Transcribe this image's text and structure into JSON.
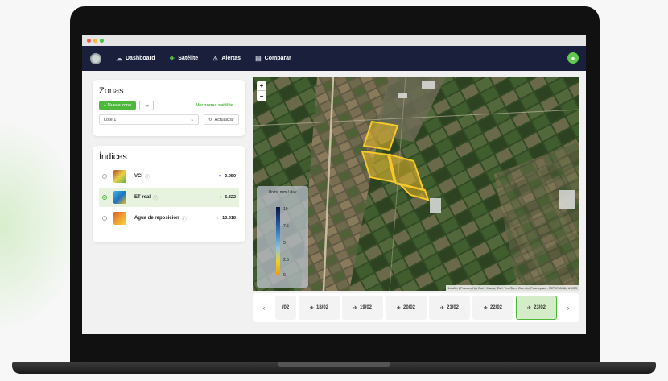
{
  "nav": {
    "items": [
      {
        "label": "Dashboard",
        "icon": "cloud-icon"
      },
      {
        "label": "Satélite",
        "icon": "satellite-icon",
        "active": true
      },
      {
        "label": "Alertas",
        "icon": "alert-icon"
      },
      {
        "label": "Comparar",
        "icon": "compare-icon"
      }
    ]
  },
  "zonas": {
    "title": "Zonas",
    "new_zone": "Nueva zona",
    "link": "Ver zonas satélite →",
    "select_value": "Lote 1",
    "update": "Actualizar"
  },
  "indices": {
    "title": "Índices",
    "items": [
      {
        "name": "VCI",
        "value": "0.950",
        "trend": "=",
        "gradient": "linear-gradient(135deg,#b84a2a,#e8d24a,#5fae4a)"
      },
      {
        "name": "ET real",
        "value": "5.322",
        "trend": "↑",
        "selected": true,
        "gradient": "linear-gradient(135deg,#3ab8e0,#2070c0,#f0c020)"
      },
      {
        "name": "Agua de reposición",
        "value": "10.618",
        "trend": "↓",
        "gradient": "linear-gradient(135deg,#e05a2a,#f0a030,#f7d640)"
      }
    ]
  },
  "map": {
    "legend_title": "Units: mm / day",
    "ticks": [
      "10",
      "7.5",
      "5",
      "2.5",
      "0"
    ],
    "attribution": "Leaflet | Powered by Esri | Maxar, Esri, TomTom, Garmin, Foursquare, METI/NASA, USGS"
  },
  "timeline": {
    "dates": [
      {
        "label": "/02",
        "partial": true
      },
      {
        "label": "18/02"
      },
      {
        "label": "19/02"
      },
      {
        "label": "20/02"
      },
      {
        "label": "21/02"
      },
      {
        "label": "22/02"
      },
      {
        "label": "23/02",
        "selected": true
      }
    ]
  }
}
